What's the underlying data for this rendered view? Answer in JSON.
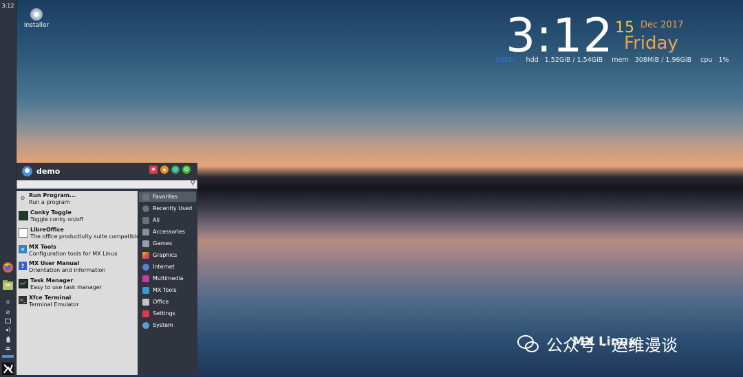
{
  "panel": {
    "clock": "3:12",
    "launchers": [
      "firefox-icon",
      "file-manager-icon"
    ],
    "tray": [
      "network-icon",
      "paperclip-icon",
      "display-icon",
      "volume-icon",
      "battery-icon",
      "eject-icon"
    ]
  },
  "desktop": {
    "icons": [
      {
        "label": "Installer",
        "icon": "disc-icon"
      }
    ]
  },
  "conky": {
    "time": "3:12",
    "day": "15",
    "month_year": "Dec 2017",
    "weekday": "Friday",
    "used_label": "USED:",
    "hdd_label": "hdd",
    "hdd_value": "1.52GiB / 1.54GiB",
    "mem_label": "mem",
    "mem_value": "308MiB / 1.96GiB",
    "cpu_label": "cpu",
    "cpu_value": "1%"
  },
  "menu": {
    "username": "demo",
    "search_placeholder": "",
    "favorites": [
      {
        "title": "Run Program...",
        "subtitle": "Run a program",
        "icon": "gear-icon"
      },
      {
        "title": "Conky Toggle",
        "subtitle": "Toggle conky on/off",
        "icon": "monitor-icon"
      },
      {
        "title": "LibreOffice",
        "subtitle": "The office productivity suite compatible...",
        "icon": "document-icon"
      },
      {
        "title": "MX Tools",
        "subtitle": "Configuration tools for MX Linux",
        "icon": "mx-tools-icon"
      },
      {
        "title": "MX User Manual",
        "subtitle": "Orientation and information",
        "icon": "help-icon"
      },
      {
        "title": "Task Manager",
        "subtitle": "Easy to use task manager",
        "icon": "task-manager-icon"
      },
      {
        "title": "Xfce Terminal",
        "subtitle": "Terminal Emulator",
        "icon": "terminal-icon"
      }
    ],
    "categories": [
      {
        "label": "Favorites",
        "color": "#6b7079"
      },
      {
        "label": "Recently Used",
        "color": "#6b7079"
      },
      {
        "label": "All",
        "color": "#6b7079"
      },
      {
        "label": "Accessories",
        "color": "#8a8f99"
      },
      {
        "label": "Games",
        "color": "#9aa0aa"
      },
      {
        "label": "Graphics",
        "color": "#e05a3a"
      },
      {
        "label": "Internet",
        "color": "#5a7fd6"
      },
      {
        "label": "Multimedia",
        "color": "#c43ab0"
      },
      {
        "label": "MX Tools",
        "color": "#3a9ad6"
      },
      {
        "label": "Office",
        "color": "#c0c4cc"
      },
      {
        "label": "Settings",
        "color": "#e03a4a"
      },
      {
        "label": "System",
        "color": "#5aa0d6"
      }
    ]
  },
  "watermark": {
    "text": "公众号 · 运维漫谈",
    "logo_text": "MX Linux"
  }
}
